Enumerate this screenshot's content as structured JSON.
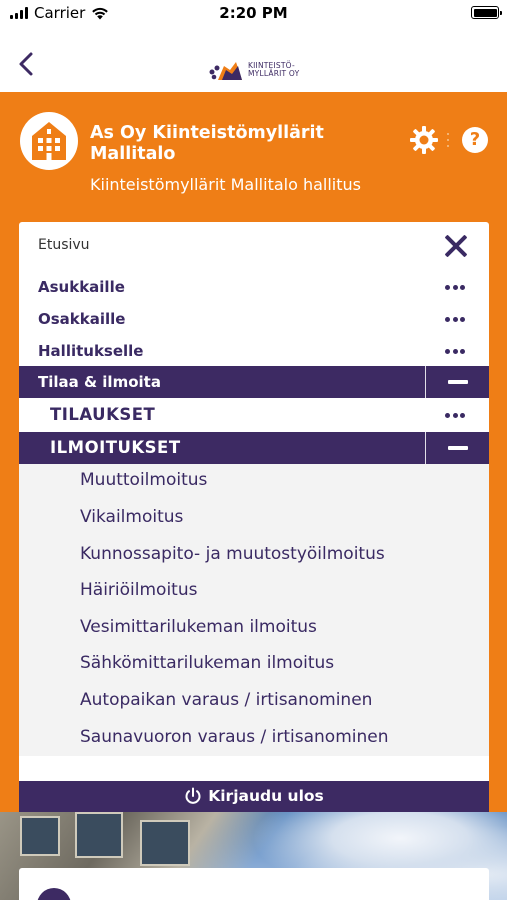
{
  "status_bar": {
    "carrier": "Carrier",
    "time": "2:20 PM"
  },
  "nav": {
    "back_icon": "chevron-left-icon",
    "logo_text_line1": "KIINTEISTÖ-",
    "logo_text_line2": "MYLLÄRIT OY"
  },
  "header": {
    "title": "As Oy Kiinteistömyllärit Mallitalo",
    "subtitle": "Kiinteistömyllärit Mallitalo hallitus",
    "help_label": "?",
    "colors": {
      "orange": "#ef7e16",
      "purple": "#3d2a63"
    }
  },
  "menu": {
    "home_label": "Etusivu",
    "sections": [
      {
        "label": "Asukkaille"
      },
      {
        "label": "Osakkaille"
      },
      {
        "label": "Hallitukselle"
      },
      {
        "label": "Tilaa & ilmoita"
      }
    ],
    "subsections": [
      {
        "label": "TILAUKSET"
      },
      {
        "label": "ILMOITUKSET"
      }
    ],
    "items": [
      "Muuttoilmoitus",
      "Vikailmoitus",
      "Kunnossapito- ja muutostyöilmoitus",
      "Häiriöilmoitus",
      "Vesimittarilukeman ilmoitus",
      "Sähkömittarilukeman ilmoitus",
      "Autopaikan varaus / irtisanominen",
      "Saunavuoron varaus / irtisanominen"
    ]
  },
  "logout": {
    "label": "Kirjaudu ulos"
  }
}
